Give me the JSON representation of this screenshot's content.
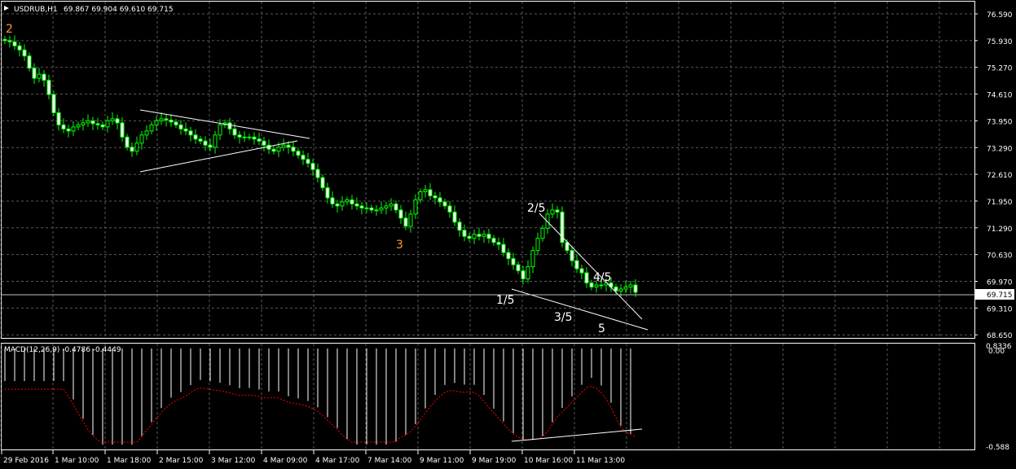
{
  "header": {
    "symbol": "USDRUB,H1",
    "ohlc": "69.867 69.904 69.610 69.715"
  },
  "price_axis": {
    "ticks": [
      "76.590",
      "75.930",
      "75.270",
      "74.610",
      "73.950",
      "73.290",
      "72.610",
      "71.950",
      "71.290",
      "70.630",
      "69.970",
      "69.310",
      "68.650"
    ],
    "current_price": "69.715"
  },
  "macd": {
    "label": "MACD(12,26,9) -0.4786 -0.4449",
    "axis_top": "0.8336",
    "axis_top_b": "0.00",
    "axis_bottom": "-0.588"
  },
  "time_axis": {
    "labels": [
      "29 Feb 2016",
      "1 Mar 10:00",
      "1 Mar 18:00",
      "2 Mar 15:00",
      "3 Mar 12:00",
      "4 Mar 09:00",
      "4 Mar 17:00",
      "7 Mar 14:00",
      "9 Mar 11:00",
      "9 Mar 19:00",
      "10 Mar 16:00",
      "11 Mar 13:00"
    ]
  },
  "wave_labels": {
    "w2": "2",
    "w3": "3",
    "w1_5": "1/5",
    "w2_5": "2/5",
    "w3_5": "3/5",
    "w4_5": "4/5",
    "w5": "5"
  },
  "colors": {
    "background": "#000000",
    "grid": "#5a5a5a",
    "candle": "#00ff00",
    "bull_body": "#000000",
    "bear_body": "#ffffff",
    "macd_signal": "#ff0000",
    "wave_orange": "#ff9933",
    "text": "#ffffff"
  },
  "chart_data": {
    "type": "candlestick",
    "symbol": "USDRUB",
    "timeframe": "H1",
    "ylim": [
      68.65,
      76.9
    ],
    "close_series": [
      75.93,
      75.9,
      75.8,
      75.7,
      75.55,
      75.25,
      75.0,
      75.1,
      74.95,
      74.6,
      74.15,
      73.85,
      73.75,
      73.7,
      73.8,
      73.85,
      73.9,
      73.95,
      73.88,
      73.85,
      73.8,
      73.95,
      74.0,
      73.9,
      73.55,
      73.3,
      73.2,
      73.4,
      73.6,
      73.7,
      73.85,
      73.95,
      74.0,
      73.97,
      73.92,
      73.85,
      73.75,
      73.7,
      73.6,
      73.5,
      73.45,
      73.35,
      73.3,
      73.6,
      73.85,
      73.9,
      73.75,
      73.6,
      73.55,
      73.55,
      73.55,
      73.5,
      73.45,
      73.35,
      73.25,
      73.2,
      73.3,
      73.35,
      73.3,
      73.2,
      73.1,
      73.0,
      72.9,
      72.75,
      72.55,
      72.3,
      72.05,
      71.9,
      71.85,
      71.95,
      72.0,
      71.9,
      71.85,
      71.8,
      71.8,
      71.75,
      71.75,
      71.8,
      71.85,
      71.9,
      71.75,
      71.55,
      71.35,
      71.65,
      72.0,
      72.2,
      72.25,
      72.1,
      72.05,
      71.95,
      71.85,
      71.7,
      71.45,
      71.25,
      71.1,
      71.05,
      71.15,
      71.1,
      71.15,
      71.05,
      70.95,
      70.9,
      70.7,
      70.55,
      70.4,
      70.25,
      70.05,
      70.35,
      70.75,
      71.05,
      71.3,
      71.65,
      71.75,
      71.7,
      70.95,
      70.75,
      70.5,
      70.3,
      70.2,
      69.95,
      69.85,
      69.9,
      69.9,
      69.95,
      69.85,
      69.75,
      69.8,
      69.85,
      69.9,
      69.72
    ]
  }
}
